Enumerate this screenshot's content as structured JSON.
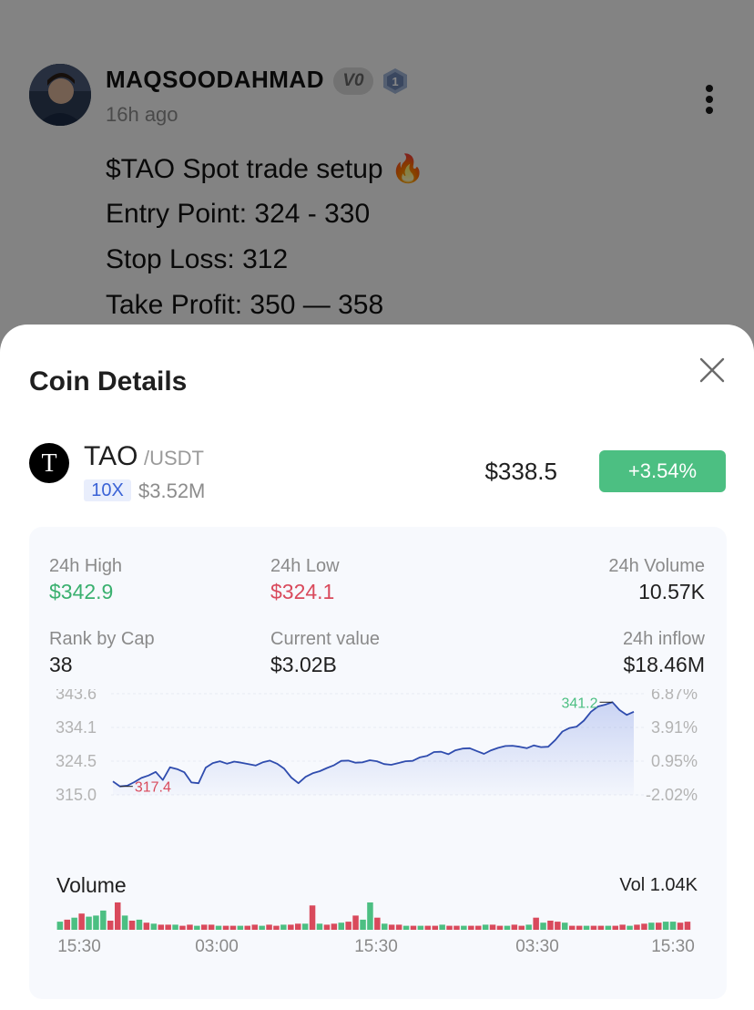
{
  "post": {
    "author": "MAQSOODAHMAD",
    "badge_vip": "V0",
    "badge_level": "1",
    "time": "16h ago",
    "lines": [
      "$TAO Spot trade setup 🔥",
      "Entry Point: 324 - 330",
      "Stop Loss: 312",
      "Take Profit: 350 — 358"
    ]
  },
  "sheet": {
    "title": "Coin Details",
    "coin": {
      "logo_letter": "T",
      "symbol": "TAO",
      "quote": "/USDT",
      "leverage": "10X",
      "volume": "$3.52M",
      "price": "$338.5",
      "change": "+3.54%"
    },
    "stats": {
      "high_label": "24h High",
      "high_value": "$342.9",
      "low_label": "24h Low",
      "low_value": "$324.1",
      "volume_label": "24h Volume",
      "volume_value": "10.57K",
      "rank_label": "Rank by Cap",
      "rank_value": "38",
      "current_label": "Current value",
      "current_value": "$3.02B",
      "inflow_label": "24h inflow",
      "inflow_value": "$18.46M"
    },
    "volume_section": {
      "title": "Volume",
      "total": "Vol 1.04K"
    }
  },
  "colors": {
    "up": "#4cbf82",
    "down": "#d94a5c",
    "line": "#2f4cae",
    "leverage_bg": "#e9eefc",
    "leverage_text": "#3b63d6"
  },
  "chart_data": {
    "type": "area",
    "y_ticks_price": [
      "343.6",
      "334.1",
      "324.5",
      "315.0"
    ],
    "y_ticks_pct": [
      "6.87%",
      "3.91%",
      "0.95%",
      "-2.02%"
    ],
    "ylim": [
      315.0,
      343.6
    ],
    "max_label": "341.2",
    "min_label": "317.4",
    "series": [
      {
        "values": [
          318.8,
          317.4,
          317.6,
          318.6,
          319.8,
          320.5,
          321.5,
          319.2,
          322.8,
          322.3,
          321.4,
          318.5,
          318.3,
          322.7,
          324.0,
          324.5,
          323.8,
          324.4,
          324.1,
          323.7,
          323.3,
          324.2,
          324.7,
          323.8,
          322.4,
          319.9,
          318.3,
          320.1,
          321.1,
          321.7,
          322.6,
          323.4,
          324.6,
          324.7,
          324.1,
          324.2,
          324.8,
          324.5,
          323.7,
          323.5,
          324.0,
          324.5,
          324.6,
          325.6,
          326.0,
          327.1,
          327.2,
          326.5,
          327.6,
          328.1,
          328.2,
          327.4,
          326.6,
          327.6,
          328.3,
          328.8,
          328.9,
          328.6,
          328.2,
          329.0,
          328.5,
          328.6,
          330.5,
          332.9,
          333.9,
          334.3,
          336.0,
          338.5,
          340.0,
          340.5,
          341.2,
          339.0,
          337.6,
          338.5
        ]
      }
    ],
    "volume": {
      "x_ticks": [
        "15:30",
        "03:00",
        "15:30",
        "03:30",
        "15:30"
      ],
      "bars": [
        {
          "v": 8,
          "up": true
        },
        {
          "v": 10,
          "up": false
        },
        {
          "v": 12,
          "up": true
        },
        {
          "v": 16,
          "up": false
        },
        {
          "v": 13,
          "up": true
        },
        {
          "v": 14,
          "up": true
        },
        {
          "v": 19,
          "up": true
        },
        {
          "v": 9,
          "up": false
        },
        {
          "v": 36,
          "up": false
        },
        {
          "v": 14,
          "up": true
        },
        {
          "v": 9,
          "up": false
        },
        {
          "v": 10,
          "up": true
        },
        {
          "v": 7,
          "up": false
        },
        {
          "v": 6,
          "up": true
        },
        {
          "v": 5,
          "up": false
        },
        {
          "v": 5,
          "up": false
        },
        {
          "v": 5,
          "up": true
        },
        {
          "v": 4,
          "up": false
        },
        {
          "v": 5,
          "up": false
        },
        {
          "v": 4,
          "up": true
        },
        {
          "v": 5,
          "up": false
        },
        {
          "v": 5,
          "up": false
        },
        {
          "v": 4,
          "up": true
        },
        {
          "v": 4,
          "up": false
        },
        {
          "v": 4,
          "up": false
        },
        {
          "v": 4,
          "up": true
        },
        {
          "v": 4,
          "up": false
        },
        {
          "v": 5,
          "up": false
        },
        {
          "v": 4,
          "up": true
        },
        {
          "v": 5,
          "up": false
        },
        {
          "v": 4,
          "up": false
        },
        {
          "v": 5,
          "up": true
        },
        {
          "v": 5,
          "up": false
        },
        {
          "v": 6,
          "up": false
        },
        {
          "v": 6,
          "up": true
        },
        {
          "v": 24,
          "up": false
        },
        {
          "v": 6,
          "up": true
        },
        {
          "v": 5,
          "up": false
        },
        {
          "v": 6,
          "up": false
        },
        {
          "v": 7,
          "up": true
        },
        {
          "v": 8,
          "up": false
        },
        {
          "v": 14,
          "up": false
        },
        {
          "v": 10,
          "up": true
        },
        {
          "v": 28,
          "up": true
        },
        {
          "v": 12,
          "up": false
        },
        {
          "v": 6,
          "up": true
        },
        {
          "v": 5,
          "up": false
        },
        {
          "v": 5,
          "up": false
        },
        {
          "v": 4,
          "up": true
        },
        {
          "v": 4,
          "up": false
        },
        {
          "v": 4,
          "up": true
        },
        {
          "v": 4,
          "up": false
        },
        {
          "v": 4,
          "up": false
        },
        {
          "v": 5,
          "up": true
        },
        {
          "v": 4,
          "up": false
        },
        {
          "v": 4,
          "up": false
        },
        {
          "v": 4,
          "up": true
        },
        {
          "v": 4,
          "up": false
        },
        {
          "v": 4,
          "up": false
        },
        {
          "v": 5,
          "up": true
        },
        {
          "v": 5,
          "up": false
        },
        {
          "v": 4,
          "up": false
        },
        {
          "v": 4,
          "up": true
        },
        {
          "v": 5,
          "up": false
        },
        {
          "v": 4,
          "up": false
        },
        {
          "v": 5,
          "up": true
        },
        {
          "v": 12,
          "up": false
        },
        {
          "v": 7,
          "up": true
        },
        {
          "v": 9,
          "up": false
        },
        {
          "v": 8,
          "up": false
        },
        {
          "v": 7,
          "up": true
        },
        {
          "v": 4,
          "up": false
        },
        {
          "v": 4,
          "up": false
        },
        {
          "v": 4,
          "up": true
        },
        {
          "v": 4,
          "up": false
        },
        {
          "v": 4,
          "up": false
        },
        {
          "v": 4,
          "up": true
        },
        {
          "v": 4,
          "up": false
        },
        {
          "v": 5,
          "up": false
        },
        {
          "v": 4,
          "up": true
        },
        {
          "v": 5,
          "up": false
        },
        {
          "v": 6,
          "up": false
        },
        {
          "v": 7,
          "up": true
        },
        {
          "v": 7,
          "up": false
        },
        {
          "v": 8,
          "up": true
        },
        {
          "v": 8,
          "up": true
        },
        {
          "v": 7,
          "up": false
        },
        {
          "v": 8,
          "up": false
        }
      ]
    }
  }
}
